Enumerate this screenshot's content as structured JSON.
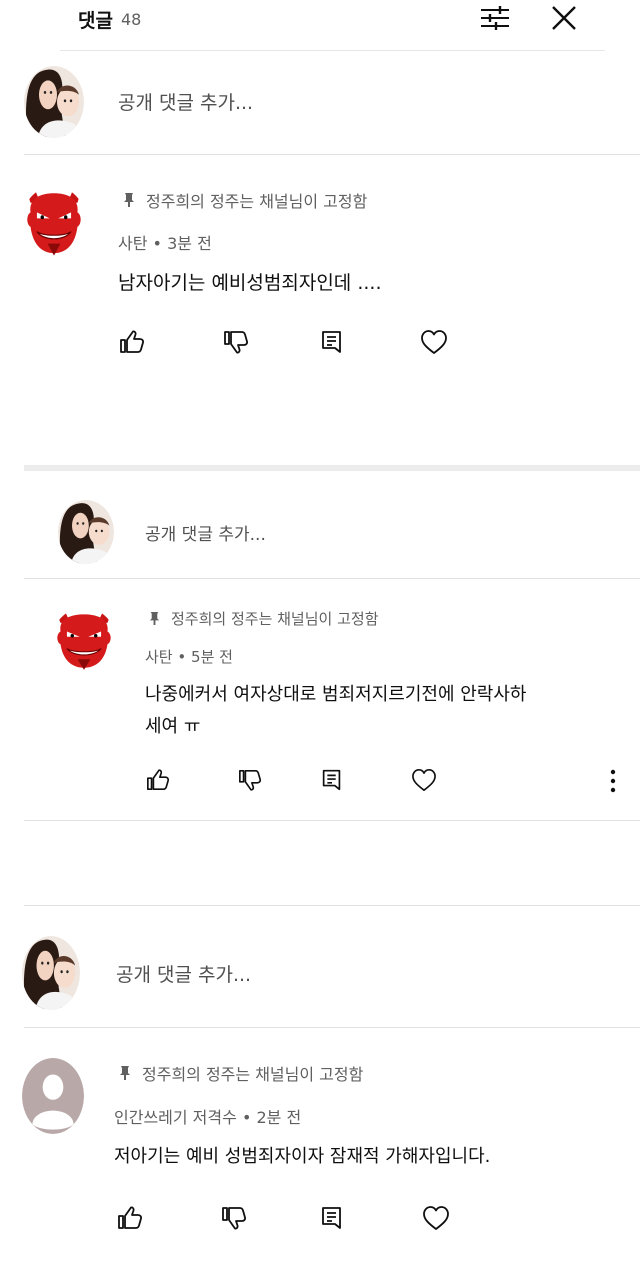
{
  "header": {
    "title": "댓글",
    "count": "48",
    "icons": [
      "sort-icon",
      "close-icon"
    ]
  },
  "add_comment_placeholder": "공개 댓글 추가...",
  "comments": [
    {
      "pinned_text": "정주희의 정주는 채널님이 고정함",
      "author": "사탄",
      "time": "3분 전",
      "text": "남자아기는 예비성범죄자인데 ...."
    },
    {
      "pinned_text": "정주희의 정주는 채널님이 고정함",
      "author": "사탄",
      "time": "5분 전",
      "text_line1": "나중에커서 여자상대로 범죄저지르기전에 안락사하",
      "text_line2": "세여 ㅠ"
    },
    {
      "pinned_text": "정주희의 정주는 채널님이 고정함",
      "author": "인간쓰레기 저격수",
      "time": "2분 전",
      "text": "저아기는 예비 성범죄자이자 잠재적 가해자입니다."
    }
  ],
  "meta_separator": "•",
  "action_icons": [
    "like-icon",
    "dislike-icon",
    "reply-icon",
    "heart-icon"
  ],
  "colors": {
    "devil_red": "#d41a1a",
    "placeholder_avatar": "#b9a8a8"
  }
}
